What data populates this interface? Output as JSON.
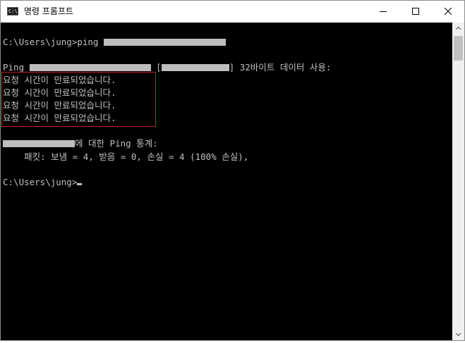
{
  "window": {
    "title": "명령 프롬프트",
    "icon_label": "C:\\."
  },
  "icons": {
    "app": "cmd-icon",
    "minimize": "minimize-icon",
    "maximize": "maximize-icon",
    "close": "close-icon",
    "scroll_up": "scroll-up-arrow-icon",
    "scroll_down": "scroll-down-arrow-icon"
  },
  "console": {
    "prompt_ping": "C:\\Users\\jung>ping ",
    "reply_header_prefix": "Ping ",
    "reply_header_bracket_open": " [",
    "reply_header_suffix": "] 32바이트 데이터 사용:",
    "timeouts": [
      "요청 시간이 만료되었습니다.",
      "요청 시간이 만료되었습니다.",
      "요청 시간이 만료되었습니다.",
      "요청 시간이 만료되었습니다."
    ],
    "stats_header_suffix": "에 대한 Ping 통계:",
    "stats_line": "    패킷: 보냄 = 4, 받음 = 0, 손실 = 4 (100% 손실),",
    "prompt_final": "C:\\Users\\jung>"
  },
  "colors": {
    "console_bg": "#000000",
    "console_text": "#c0c0c0",
    "highlight_box": "#c72020",
    "redaction": "#bdbdbd"
  }
}
